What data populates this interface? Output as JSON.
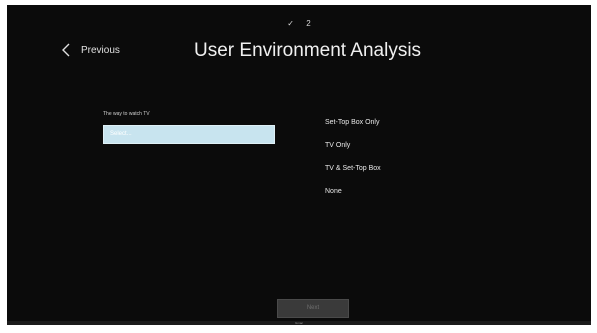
{
  "steps": {
    "done_mark": "✓",
    "current": "2"
  },
  "header": {
    "back_label": "Previous",
    "back_icon": "chevron-left-icon",
    "title": "User Environment Analysis"
  },
  "form": {
    "field_label": "The way to watch TV",
    "select_value": "Select..."
  },
  "options": [
    "Set-Top Box Only",
    "TV Only",
    "TV & Set-Top Box",
    "None"
  ],
  "footer": {
    "next_label": "Next",
    "caption": "Gmac"
  },
  "colors": {
    "background": "#0b0b0b",
    "select_fill": "#c8e4ef",
    "button_disabled": "#3a3a3a"
  }
}
